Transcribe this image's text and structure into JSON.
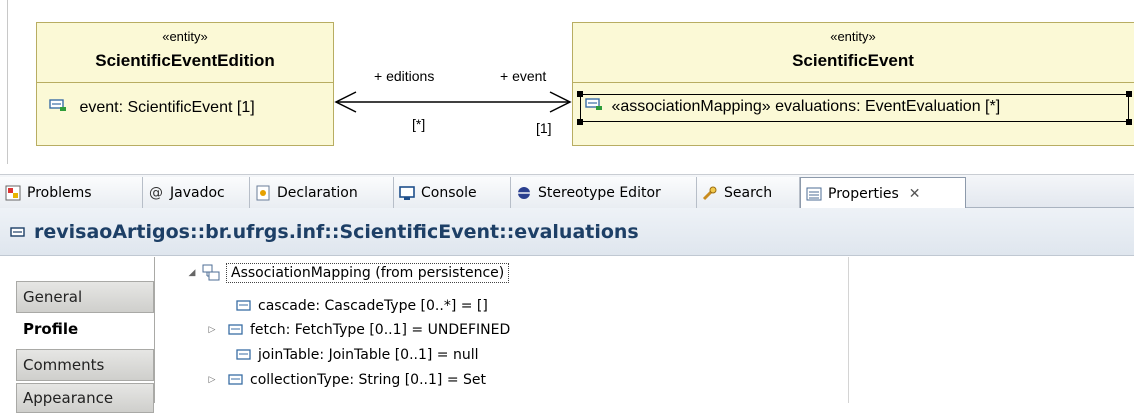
{
  "diagram": {
    "left_class": {
      "stereotype": "«entity»",
      "name": "ScientificEventEdition",
      "attribute": "event: ScientificEvent [1]"
    },
    "right_class": {
      "stereotype": "«entity»",
      "name": "ScientificEvent",
      "attribute": "«associationMapping»  evaluations: EventEvaluation [*]"
    },
    "association": {
      "left_role": "+ editions",
      "right_role": "+ event",
      "left_multiplicity": "[*]",
      "right_multiplicity": "[1]"
    }
  },
  "tabs": [
    {
      "label": "Problems",
      "icon": "problems-icon"
    },
    {
      "label": "Javadoc",
      "icon": "javadoc-icon"
    },
    {
      "label": "Declaration",
      "icon": "declaration-icon"
    },
    {
      "label": "Console",
      "icon": "console-icon"
    },
    {
      "label": "Stereotype Editor",
      "icon": "stereotype-icon"
    },
    {
      "label": "Search",
      "icon": "search-icon"
    },
    {
      "label": "Properties",
      "icon": "properties-icon",
      "active": true
    }
  ],
  "properties": {
    "title": "revisaoArtigos::br.ufrgs.inf::ScientificEvent::evaluations",
    "nav": [
      "General",
      "Profile",
      "Comments",
      "Appearance"
    ],
    "active_nav": "Profile",
    "tree": {
      "root": "AssociationMapping    (from persistence)",
      "items": [
        {
          "label": "cascade: CascadeType [0..*] = []",
          "expandable": false
        },
        {
          "label": "fetch: FetchType [0..1] = UNDEFINED",
          "expandable": true
        },
        {
          "label": "joinTable: JoinTable [0..1] = null",
          "expandable": false
        },
        {
          "label": "collectionType: String [0..1] = Set",
          "expandable": true
        }
      ]
    }
  }
}
